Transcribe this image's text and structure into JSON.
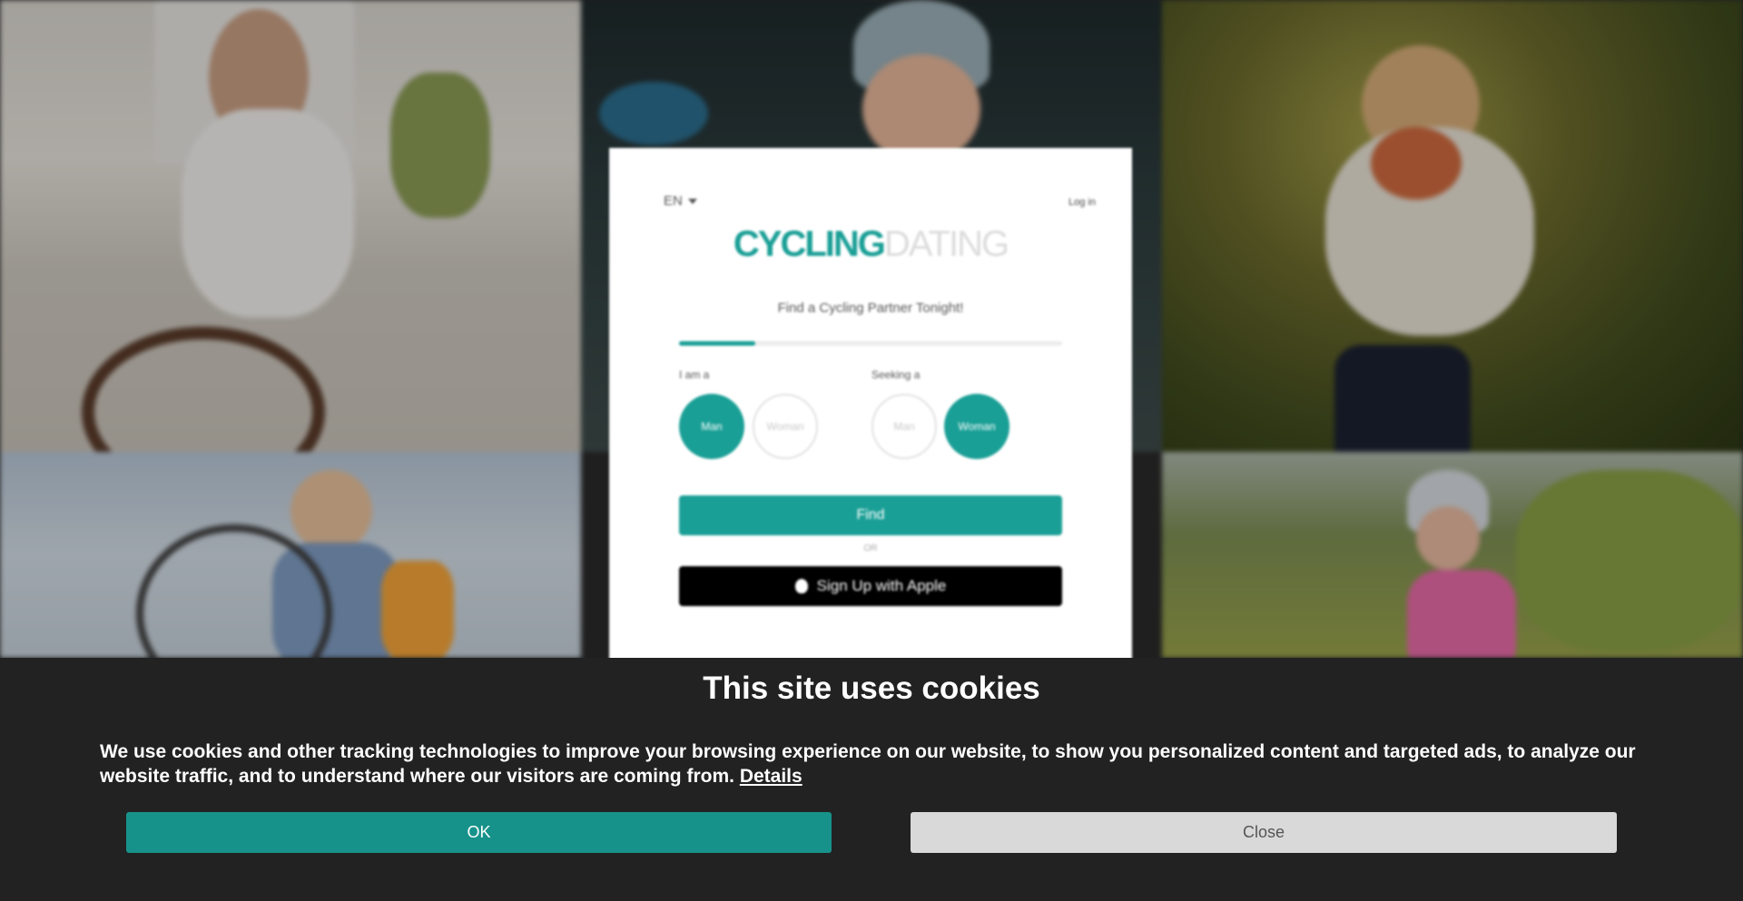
{
  "signup": {
    "language": "EN",
    "login_label": "Log in",
    "logo_part1": "CYCLING",
    "logo_part2": "DATING",
    "tagline": "Find a Cycling Partner Tonight!",
    "progress": 0.2,
    "i_am_label": "I am a",
    "seeking_label": "Seeking a",
    "i_am_options": [
      "Man",
      "Woman"
    ],
    "i_am_selected": "Man",
    "seeking_options": [
      "Man",
      "Woman"
    ],
    "seeking_selected": "Woman",
    "find_label": "Find",
    "or_label": "OR",
    "apple_label": "Sign Up with Apple"
  },
  "cookie": {
    "title": "This site uses cookies",
    "text": "We use cookies and other tracking technologies to improve your browsing experience on our website, to show you personalized content and targeted ads, to analyze our website traffic, and to understand where our visitors are coming from.",
    "details_label": "Details",
    "ok_label": "OK",
    "close_label": "Close"
  },
  "colors": {
    "accent": "#1a9f96",
    "banner_bg": "#222222",
    "ok_button": "#17928a",
    "close_button": "#d9d9d9"
  }
}
